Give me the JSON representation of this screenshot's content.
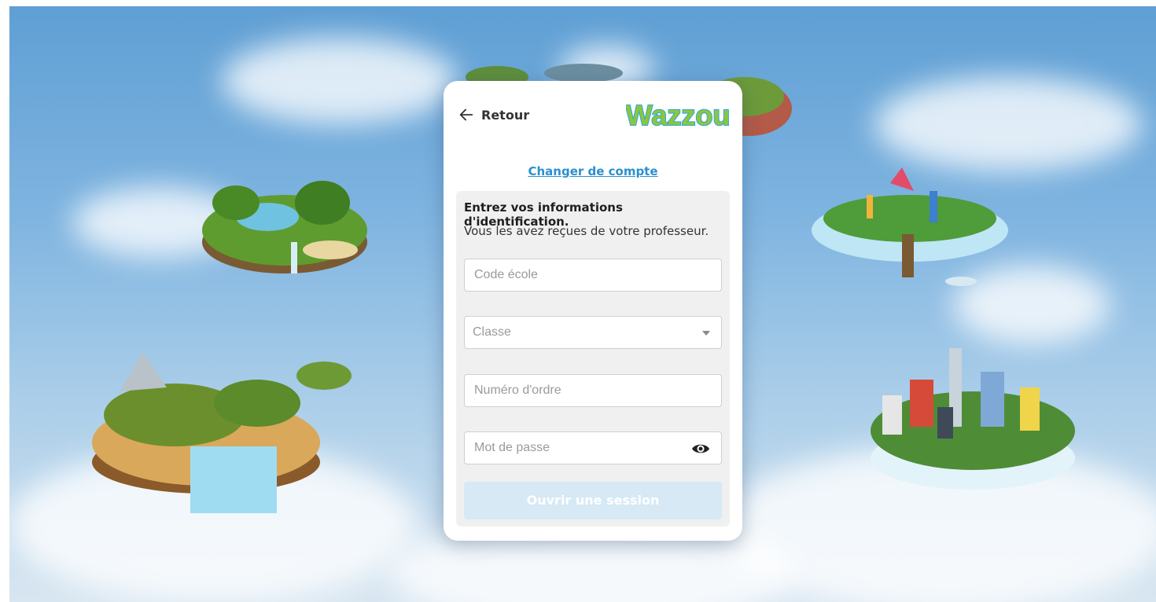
{
  "header": {
    "back_label": "Retour",
    "logo_text": "Wazzou"
  },
  "account": {
    "switch_label": "Changer de compte"
  },
  "form": {
    "title": "Entrez vos informations d'identification.",
    "subtitle": "Vous les avez reçues de votre professeur.",
    "school_code_placeholder": "Code école",
    "class_placeholder": "Classe",
    "order_number_placeholder": "Numéro d'ordre",
    "password_placeholder": "Mot de passe",
    "submit_label": "Ouvrir une session"
  },
  "colors": {
    "link": "#2a8fd0",
    "submit_disabled": "#d6e9f5",
    "logo_green": "#8cc63f",
    "logo_blue": "#29a8e0"
  },
  "icons": {
    "back": "arrow-left-icon",
    "password_toggle": "eye-icon",
    "select": "chevron-down-icon"
  }
}
